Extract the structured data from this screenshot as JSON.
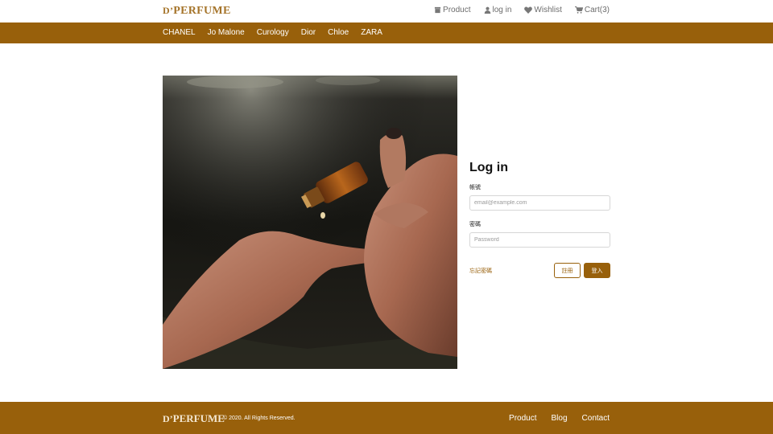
{
  "header": {
    "logo_prefix": "D’",
    "logo_main": "PERFUME",
    "nav": [
      {
        "label": "Product",
        "icon": "store-icon"
      },
      {
        "label": "log in",
        "icon": "user-icon"
      },
      {
        "label": "Wishlist",
        "icon": "heart-icon"
      },
      {
        "label": "Cart(3)",
        "icon": "cart-icon"
      }
    ]
  },
  "brands": [
    "CHANEL",
    "Jo Malone",
    "Curology",
    "Dior",
    "Chloe",
    "ZARA"
  ],
  "login": {
    "title": "Log in",
    "account_label": "帳號",
    "account_placeholder": "email@example.com",
    "password_label": "密碼",
    "password_placeholder": "Password",
    "forgot_label": "忘記密碼",
    "register_label": "註冊",
    "submit_label": "登入"
  },
  "footer": {
    "logo_prefix": "D’",
    "logo_main": "PERFUME",
    "copyright": "© 2020. All Rights Reserved.",
    "links": [
      "Product",
      "Blog",
      "Contact"
    ]
  },
  "colors": {
    "brand": "#98600b",
    "logo": "#a5742a"
  }
}
